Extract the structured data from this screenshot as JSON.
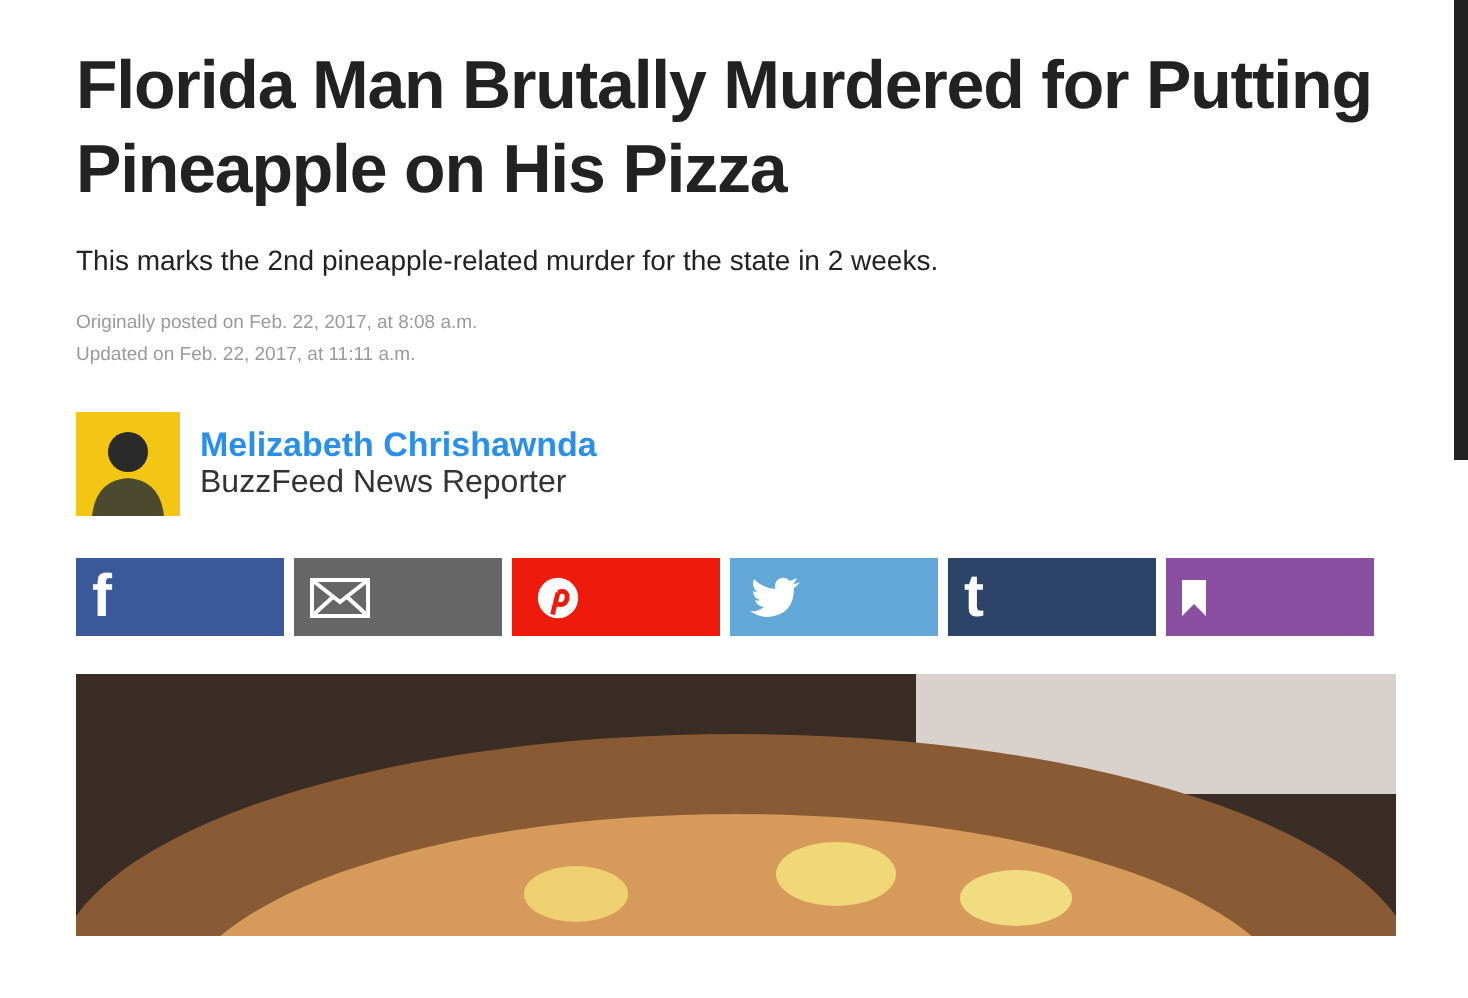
{
  "article": {
    "headline": "Florida Man Brutally Murdered for Putting Pineapple on His Pizza",
    "dek": "This marks the 2nd pineapple-related murder for the state in 2 weeks.",
    "timestamps": [
      "Originally posted on Feb. 22, 2017, at 8:08 a.m.",
      "Updated on Feb. 22, 2017, at 11:11 a.m."
    ]
  },
  "author": {
    "name": "Melizabeth Chrishawnda",
    "role": "BuzzFeed News Reporter"
  },
  "share_buttons": [
    {
      "kind": "facebook",
      "label": "f",
      "color": "#3b5998"
    },
    {
      "kind": "email",
      "color": "#666666"
    },
    {
      "kind": "pinterest",
      "color": "#ee1b0d"
    },
    {
      "kind": "twitter",
      "color": "#62a8d6"
    },
    {
      "kind": "tumblr",
      "label": "t",
      "color": "#2b4467"
    },
    {
      "kind": "bookmark",
      "color": "#8a4fa0"
    }
  ]
}
